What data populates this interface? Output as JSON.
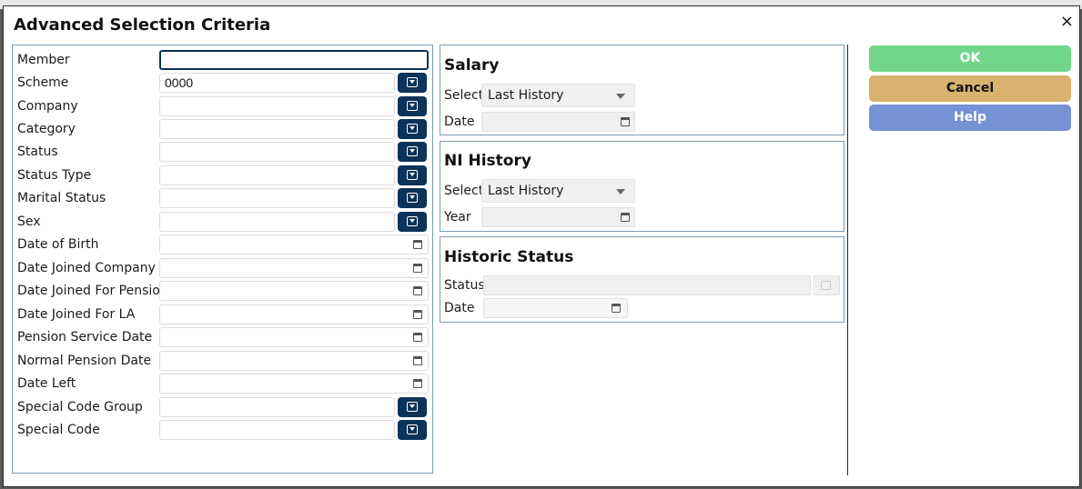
{
  "dialog": {
    "title": "Advanced Selection Criteria",
    "close_label": "×"
  },
  "criteria": {
    "member": {
      "label": "Member",
      "value": ""
    },
    "scheme": {
      "label": "Scheme",
      "value": "0000"
    },
    "company": {
      "label": "Company",
      "value": ""
    },
    "category": {
      "label": "Category",
      "value": ""
    },
    "status": {
      "label": "Status",
      "value": ""
    },
    "status_type": {
      "label": "Status Type",
      "value": ""
    },
    "marital_status": {
      "label": "Marital Status",
      "value": ""
    },
    "sex": {
      "label": "Sex",
      "value": ""
    },
    "date_of_birth": {
      "label": "Date of Birth",
      "value": ""
    },
    "date_joined_company": {
      "label": "Date Joined Company",
      "value": ""
    },
    "date_joined_pension": {
      "label": "Date Joined For Pension",
      "value": ""
    },
    "date_joined_la": {
      "label": "Date Joined For LA",
      "value": ""
    },
    "pension_service_date": {
      "label": "Pension Service Date",
      "value": ""
    },
    "normal_pension_date": {
      "label": "Normal Pension Date",
      "value": ""
    },
    "date_left": {
      "label": "Date Left",
      "value": ""
    },
    "special_code_group": {
      "label": "Special Code Group",
      "value": ""
    },
    "special_code": {
      "label": "Special Code",
      "value": ""
    }
  },
  "salary": {
    "title": "Salary",
    "select_label": "Select",
    "select_value": "Last History",
    "date_label": "Date"
  },
  "ni_history": {
    "title": "NI History",
    "select_label": "Select",
    "select_value": "Last History",
    "year_label": "Year"
  },
  "historic_status": {
    "title": "Historic Status",
    "status_label": "Status",
    "date_label": "Date"
  },
  "buttons": {
    "ok": "OK",
    "cancel": "Cancel",
    "help": "Help"
  },
  "icons": {
    "lookup": "dropdown-box-icon",
    "calendar": "calendar-icon",
    "close": "close-icon"
  },
  "colors": {
    "ok": "#72d68a",
    "cancel": "#d8b26e",
    "help": "#7592d6",
    "lookup_button": "#0c3359"
  }
}
